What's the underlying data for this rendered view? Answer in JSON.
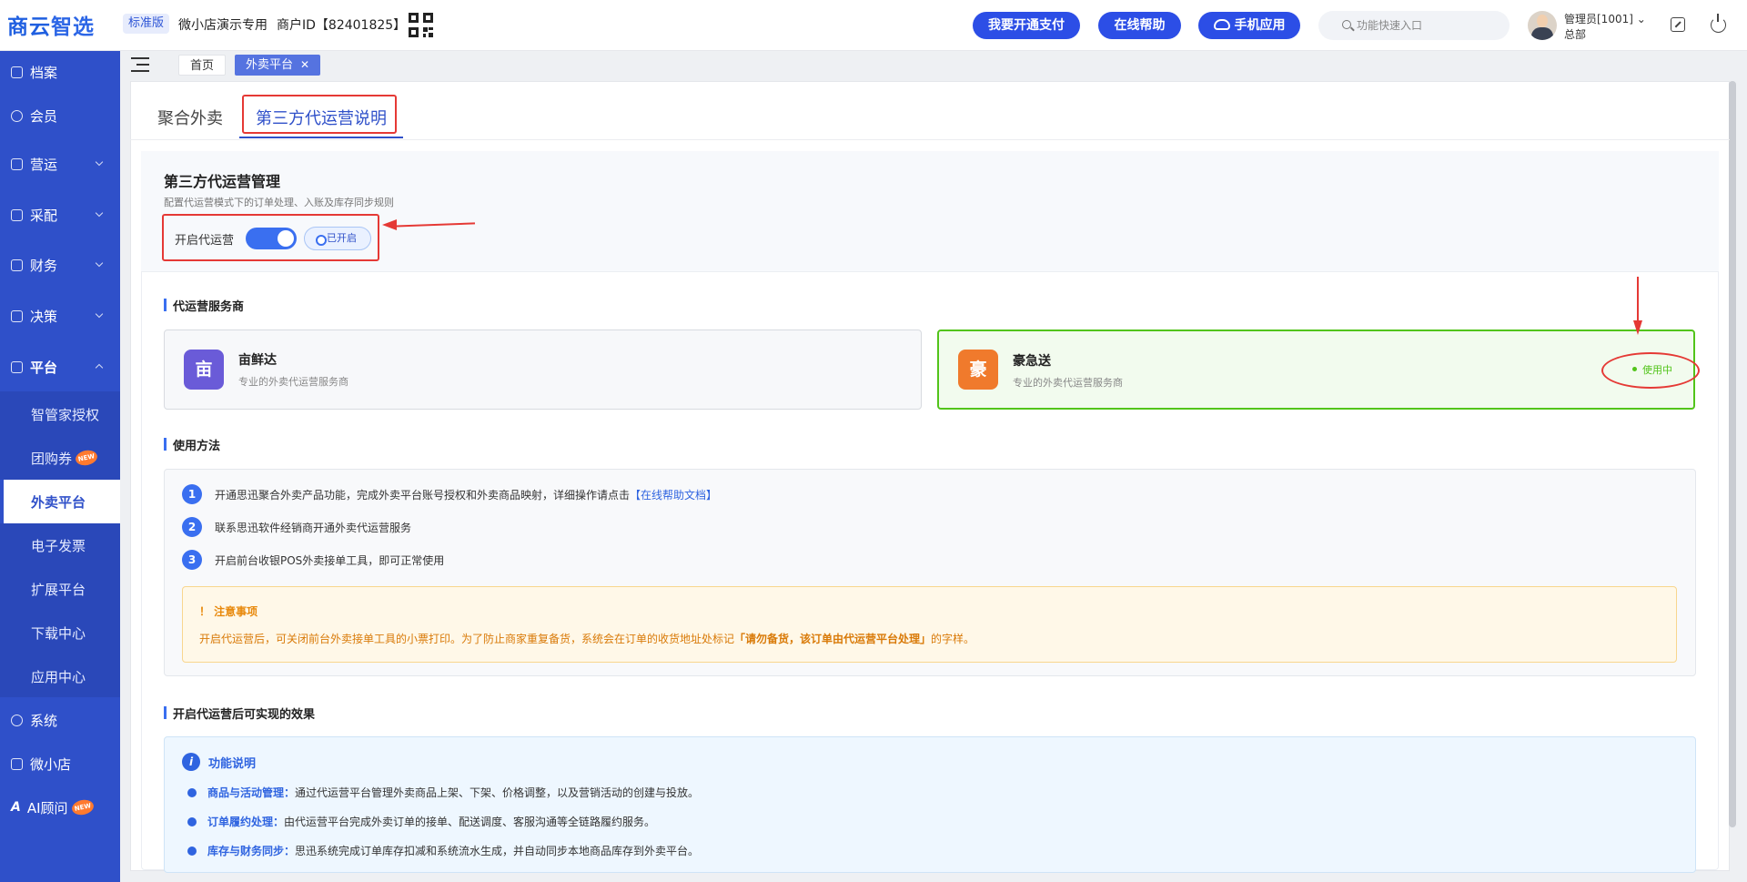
{
  "header": {
    "logo_a": "商云",
    "logo_b": "智选",
    "edition": "标准版",
    "shop_name": "微小店演示专用",
    "merchant_id": "商户ID【82401825】",
    "buttons": [
      "我要开通支付",
      "在线帮助",
      "手机应用"
    ],
    "search_placeholder": "功能快速入口",
    "user_name": "管理员[1001] ⌄",
    "user_org": "总部"
  },
  "sidebar": {
    "items": [
      {
        "label": "档案",
        "icon": "archive-icon"
      },
      {
        "label": "会员",
        "icon": "member-icon"
      },
      {
        "label": "营运",
        "icon": "operation-icon"
      },
      {
        "label": "采配",
        "icon": "purchase-icon"
      },
      {
        "label": "财务",
        "icon": "finance-icon"
      },
      {
        "label": "决策",
        "icon": "decision-icon"
      },
      {
        "label": "平台",
        "icon": "platform-icon"
      }
    ],
    "sub_items": [
      "智管家授权",
      "团购券",
      "外卖平台",
      "电子发票",
      "扩展平台",
      "下载中心",
      "应用中心"
    ],
    "new_badge": "NEW",
    "bottom_items": [
      "系统",
      "微小店",
      "AI顾问"
    ]
  },
  "tabs_bar": {
    "home": "首页",
    "current": "外卖平台",
    "close": "✕"
  },
  "page_tabs": [
    "聚合外卖",
    "第三方代运营说明"
  ],
  "manage": {
    "title": "第三方代运营管理",
    "desc": "配置代运营模式下的订单处理、入账及库存同步规则",
    "toggle_label": "开启代运营",
    "toggle_on": true,
    "status": "已开启"
  },
  "providers": {
    "section_title": "代运营服务商",
    "items": [
      {
        "logo": "亩",
        "name": "亩鲜达",
        "desc": "专业的外卖代运营服务商"
      },
      {
        "logo": "豪",
        "name": "豪急送",
        "desc": "专业的外卖代运营服务商",
        "status": "使用中"
      }
    ]
  },
  "usage": {
    "section_title": "使用方法",
    "steps": [
      {
        "num": "1",
        "text": "开通思迅聚合外卖产品功能，完成外卖平台账号授权和外卖商品映射，详细操作请点击",
        "link": "【在线帮助文档】"
      },
      {
        "num": "2",
        "text": "联系思迅软件经销商开通外卖代运营服务"
      },
      {
        "num": "3",
        "text": "开启前台收银POS外卖接单工具，即可正常使用"
      }
    ],
    "notice_title": "！ 注意事项",
    "notice_text_a": "开启代运营后，可关闭前台外卖接单工具的小票打印。为了防止商家重复备货，系统会在订单的收货地址处标记",
    "notice_text_b": "「请勿备货，该订单由代运营平台处理」",
    "notice_text_c": "的字样。"
  },
  "effects": {
    "section_title": "开启代运营后可实现的效果",
    "head": "功能说明",
    "info_glyph": "i",
    "items": [
      {
        "title": "商品与活动管理：",
        "text": "通过代运营平台管理外卖商品上架、下架、价格调整，以及营销活动的创建与投放。"
      },
      {
        "title": "订单履约处理：",
        "text": "由代运营平台完成外卖订单的接单、配送调度、客服沟通等全链路履约服务。"
      },
      {
        "title": "库存与财务同步：",
        "text": "思迅系统完成订单库存扣减和系统流水生成，并自动同步本地商品库存到外卖平台。"
      }
    ]
  }
}
